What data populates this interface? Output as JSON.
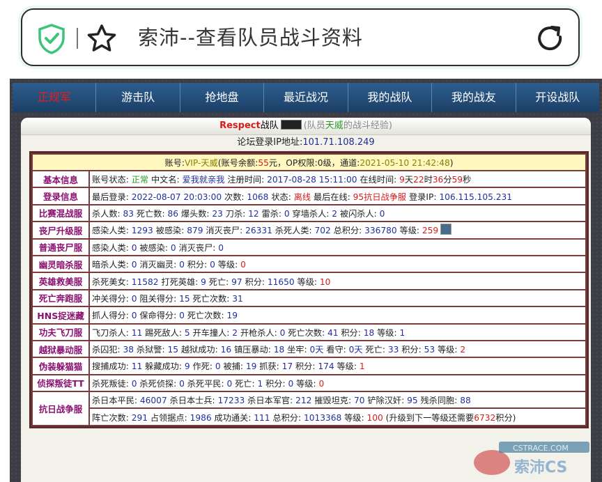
{
  "addressbar": {
    "title": "索沛--查看队员战斗资料"
  },
  "nav": [
    "正规军",
    "游击队",
    "抢地盘",
    "最近战况",
    "我的战队",
    "我的战友",
    "开设战队"
  ],
  "header": {
    "team": "Respect",
    "team_suffix": "战队",
    "paren_open": "(队员",
    "member": "天威",
    "paren_close": "的战斗经验)"
  },
  "ip_line": {
    "label": "论坛登录IP地址:",
    "ip": "101.71.108.249"
  },
  "account": {
    "prefix": "账号:",
    "name": "VIP-天威",
    "bal_label": "(账号余额:",
    "bal": "55",
    "yuan": "元，OP权限:",
    "op": "0级",
    "channel": "，通道:",
    "time": "2021-05-10 21:42:48",
    "close": ")"
  },
  "rows": [
    {
      "label": "基本信息",
      "parts": [
        [
          "账号状态: ",
          "t"
        ],
        [
          "正常",
          "g"
        ],
        [
          " 中文名: ",
          "t"
        ],
        [
          "爱我就亲我",
          "b"
        ],
        [
          " 注册时间: ",
          "t"
        ],
        [
          "2017-08-28 15:11:00",
          "b"
        ],
        [
          " 在线时间: ",
          "t"
        ],
        [
          "9",
          "r"
        ],
        [
          "天",
          "t"
        ],
        [
          "22",
          "r"
        ],
        [
          "时",
          "t"
        ],
        [
          "36",
          "r"
        ],
        [
          "分",
          "t"
        ],
        [
          "59",
          "r"
        ],
        [
          "秒",
          "t"
        ]
      ]
    },
    {
      "label": "登录信息",
      "parts": [
        [
          "最后登录: ",
          "t"
        ],
        [
          "2022-08-07 20:03:00",
          "b"
        ],
        [
          " 次数: ",
          "t"
        ],
        [
          "1068",
          "b"
        ],
        [
          " 状态: ",
          "t"
        ],
        [
          "离线",
          "r"
        ],
        [
          " 最后在线: ",
          "t"
        ],
        [
          "95抗日战争服",
          "r"
        ],
        [
          " 登录IP: ",
          "t"
        ],
        [
          "106.115.105.231",
          "b"
        ]
      ]
    },
    {
      "label": "比赛混战服",
      "parts": [
        [
          "杀人数: ",
          "t"
        ],
        [
          "83",
          "b"
        ],
        [
          " 死亡数: ",
          "t"
        ],
        [
          "86",
          "b"
        ],
        [
          " 爆头数: ",
          "t"
        ],
        [
          "23",
          "b"
        ],
        [
          " 刀杀: ",
          "t"
        ],
        [
          "12",
          "b"
        ],
        [
          " 雷杀: ",
          "t"
        ],
        [
          "0",
          "b"
        ],
        [
          " 穿墙杀人: ",
          "t"
        ],
        [
          "2",
          "b"
        ],
        [
          " 被闪杀人: ",
          "t"
        ],
        [
          "0",
          "b"
        ]
      ]
    },
    {
      "label": "丧尸升级服",
      "parts": [
        [
          "感染人类: ",
          "t"
        ],
        [
          "1293",
          "b"
        ],
        [
          " 被感染: ",
          "t"
        ],
        [
          "879",
          "b"
        ],
        [
          " 消灭丧尸: ",
          "t"
        ],
        [
          "26331",
          "b"
        ],
        [
          " 杀死人类: ",
          "t"
        ],
        [
          "702",
          "b"
        ],
        [
          " 总积分: ",
          "t"
        ],
        [
          "336780",
          "b"
        ],
        [
          " 等级: ",
          "t"
        ],
        [
          "259",
          "r"
        ]
      ],
      "avatar": true
    },
    {
      "label": "普通丧尸服",
      "parts": [
        [
          "感染人类: ",
          "t"
        ],
        [
          "0",
          "b"
        ],
        [
          " 被感染: ",
          "t"
        ],
        [
          "0",
          "b"
        ],
        [
          " 消灭丧尸: ",
          "t"
        ],
        [
          "0",
          "b"
        ]
      ]
    },
    {
      "label": "幽灵暗杀服",
      "parts": [
        [
          "暗杀人类: ",
          "t"
        ],
        [
          "0",
          "b"
        ],
        [
          " 消灭幽灵: ",
          "t"
        ],
        [
          "0",
          "b"
        ],
        [
          " 积分: ",
          "t"
        ],
        [
          "0",
          "b"
        ],
        [
          " 等级: ",
          "t"
        ],
        [
          "0",
          "r"
        ]
      ]
    },
    {
      "label": "英雄救美服",
      "parts": [
        [
          "杀死美女: ",
          "t"
        ],
        [
          "11582",
          "b"
        ],
        [
          " 打死英雄: ",
          "t"
        ],
        [
          "9",
          "b"
        ],
        [
          " 死亡: ",
          "t"
        ],
        [
          "97",
          "b"
        ],
        [
          " 积分: ",
          "t"
        ],
        [
          "11650",
          "b"
        ],
        [
          " 等级: ",
          "t"
        ],
        [
          "10",
          "r"
        ]
      ]
    },
    {
      "label": "死亡奔跑服",
      "parts": [
        [
          "冲关得分: ",
          "t"
        ],
        [
          "0",
          "b"
        ],
        [
          " 阻关得分: ",
          "t"
        ],
        [
          "15",
          "b"
        ],
        [
          " 死亡次数: ",
          "t"
        ],
        [
          "31",
          "b"
        ]
      ]
    },
    {
      "label": "HNS捉迷藏",
      "parts": [
        [
          "抓人得分: ",
          "t"
        ],
        [
          "0",
          "b"
        ],
        [
          " 保命得分: ",
          "t"
        ],
        [
          "0",
          "b"
        ],
        [
          " 死亡次数: ",
          "t"
        ],
        [
          "19",
          "b"
        ]
      ]
    },
    {
      "label": "功夫飞刀服",
      "parts": [
        [
          "飞刀杀人: ",
          "t"
        ],
        [
          "11",
          "b"
        ],
        [
          " 踢死敌人: ",
          "t"
        ],
        [
          "5",
          "b"
        ],
        [
          " 开车撞人: ",
          "t"
        ],
        [
          "2",
          "b"
        ],
        [
          " 开枪杀人: ",
          "t"
        ],
        [
          "0",
          "b"
        ],
        [
          " 死亡次数: ",
          "t"
        ],
        [
          "41",
          "b"
        ],
        [
          " 积分: ",
          "t"
        ],
        [
          "18",
          "b"
        ],
        [
          " 等级: ",
          "t"
        ],
        [
          "1",
          "b"
        ]
      ]
    },
    {
      "label": "越狱暴动服",
      "parts": [
        [
          "杀囚犯: ",
          "t"
        ],
        [
          "38",
          "b"
        ],
        [
          " 杀狱警: ",
          "t"
        ],
        [
          "15",
          "b"
        ],
        [
          " 越狱成功: ",
          "t"
        ],
        [
          "16",
          "b"
        ],
        [
          " 镇压暴动: ",
          "t"
        ],
        [
          "18",
          "b"
        ],
        [
          " 坐牢: ",
          "t"
        ],
        [
          "0天",
          "b"
        ],
        [
          " 看守: ",
          "t"
        ],
        [
          "0天",
          "b"
        ],
        [
          " 死亡: ",
          "t"
        ],
        [
          "33",
          "b"
        ],
        [
          " 积分: ",
          "t"
        ],
        [
          "53",
          "b"
        ],
        [
          " 等级: ",
          "t"
        ],
        [
          "2",
          "r"
        ]
      ]
    },
    {
      "label": "伪装躲猫猫",
      "parts": [
        [
          "搜捕成功: ",
          "t"
        ],
        [
          "11",
          "b"
        ],
        [
          " 躲藏成功: ",
          "t"
        ],
        [
          "9",
          "b"
        ],
        [
          " 作死: ",
          "t"
        ],
        [
          "0",
          "b"
        ],
        [
          " 被捕: ",
          "t"
        ],
        [
          "19",
          "b"
        ],
        [
          " 抓获: ",
          "t"
        ],
        [
          "17",
          "b"
        ],
        [
          " 积分: ",
          "t"
        ],
        [
          "174",
          "b"
        ],
        [
          " 等级: ",
          "t"
        ],
        [
          "1",
          "r"
        ]
      ]
    },
    {
      "label": "侦探叛徒TT",
      "parts": [
        [
          "杀死叛徒: ",
          "t"
        ],
        [
          "0",
          "b"
        ],
        [
          " 杀死侦探: ",
          "t"
        ],
        [
          "0",
          "b"
        ],
        [
          " 杀死平民: ",
          "t"
        ],
        [
          "0",
          "b"
        ],
        [
          " 死亡: ",
          "t"
        ],
        [
          "1",
          "b"
        ],
        [
          " 积分: ",
          "t"
        ],
        [
          "0",
          "b"
        ],
        [
          " 等级: ",
          "t"
        ],
        [
          "0",
          "r"
        ]
      ]
    }
  ],
  "kangri": {
    "label": "抗日战争服",
    "line1": [
      [
        "杀日本平民: ",
        "t"
      ],
      [
        "46007",
        "b"
      ],
      [
        " 杀日本士兵: ",
        "t"
      ],
      [
        "17233",
        "b"
      ],
      [
        " 杀日本军官: ",
        "t"
      ],
      [
        "212",
        "b"
      ],
      [
        " 摧毁坦克: ",
        "t"
      ],
      [
        "70",
        "b"
      ],
      [
        " 铲除汉奸: ",
        "t"
      ],
      [
        "95",
        "b"
      ],
      [
        " 残杀同胞: ",
        "t"
      ],
      [
        "88",
        "b"
      ]
    ],
    "line2": [
      [
        "阵亡次数: ",
        "t"
      ],
      [
        "291",
        "b"
      ],
      [
        " 占领据点: ",
        "t"
      ],
      [
        "1986",
        "b"
      ],
      [
        " 成功通关: ",
        "t"
      ],
      [
        "111",
        "b"
      ],
      [
        " 总积分: ",
        "t"
      ],
      [
        "1013368",
        "b"
      ],
      [
        " 等级: ",
        "t"
      ],
      [
        "100",
        "r"
      ],
      [
        " (升级到下一等级还需要",
        "t"
      ],
      [
        "6732",
        "r"
      ],
      [
        "积分)",
        "t"
      ]
    ]
  },
  "watermark": {
    "site": "CSTRACE.COM",
    "brand": "索沛CS"
  },
  "colors": {
    "nav_bg": "#1c3f66",
    "active": "#e02020",
    "label": "#8a1070",
    "value": "#1f2f9f",
    "accent": "#d61c1c",
    "table_border": "#7b3b3b"
  }
}
